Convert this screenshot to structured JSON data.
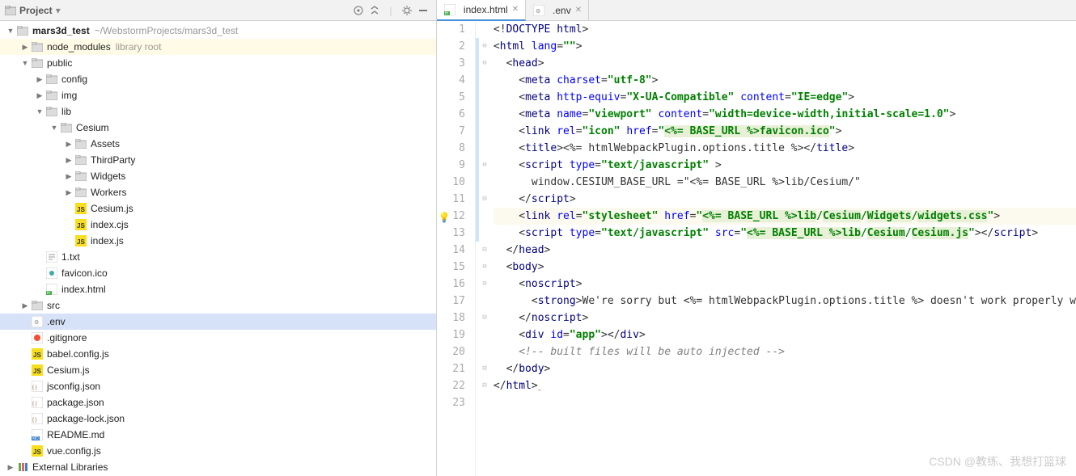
{
  "sidebar": {
    "title": "Project",
    "project_row": {
      "name": "mars3d_test",
      "path": "~/WebstormProjects/mars3d_test"
    },
    "tree": [
      {
        "indent": 0,
        "arrow": "down",
        "icon": "folder-root",
        "label": "mars3d_test",
        "bold": true,
        "hint": "~/WebstormProjects/mars3d_test"
      },
      {
        "indent": 1,
        "arrow": "right",
        "icon": "folder",
        "label": "node_modules",
        "hint": "library root",
        "class": "lib-root"
      },
      {
        "indent": 1,
        "arrow": "down",
        "icon": "folder",
        "label": "public"
      },
      {
        "indent": 2,
        "arrow": "right",
        "icon": "folder",
        "label": "config"
      },
      {
        "indent": 2,
        "arrow": "right",
        "icon": "folder",
        "label": "img"
      },
      {
        "indent": 2,
        "arrow": "down",
        "icon": "folder",
        "label": "lib"
      },
      {
        "indent": 3,
        "arrow": "down",
        "icon": "folder",
        "label": "Cesium"
      },
      {
        "indent": 4,
        "arrow": "right",
        "icon": "folder",
        "label": "Assets"
      },
      {
        "indent": 4,
        "arrow": "right",
        "icon": "folder",
        "label": "ThirdParty"
      },
      {
        "indent": 4,
        "arrow": "right",
        "icon": "folder",
        "label": "Widgets"
      },
      {
        "indent": 4,
        "arrow": "right",
        "icon": "folder",
        "label": "Workers"
      },
      {
        "indent": 4,
        "arrow": "none",
        "icon": "js",
        "label": "Cesium.js"
      },
      {
        "indent": 4,
        "arrow": "none",
        "icon": "js",
        "label": "index.cjs"
      },
      {
        "indent": 4,
        "arrow": "none",
        "icon": "js",
        "label": "index.js"
      },
      {
        "indent": 2,
        "arrow": "none",
        "icon": "txt",
        "label": "1.txt"
      },
      {
        "indent": 2,
        "arrow": "none",
        "icon": "ico",
        "label": "favicon.ico"
      },
      {
        "indent": 2,
        "arrow": "none",
        "icon": "html",
        "label": "index.html"
      },
      {
        "indent": 1,
        "arrow": "right",
        "icon": "folder",
        "label": "src"
      },
      {
        "indent": 1,
        "arrow": "none",
        "icon": "env",
        "label": ".env",
        "class": "selected"
      },
      {
        "indent": 1,
        "arrow": "none",
        "icon": "gitignore",
        "label": ".gitignore"
      },
      {
        "indent": 1,
        "arrow": "none",
        "icon": "js",
        "label": "babel.config.js"
      },
      {
        "indent": 1,
        "arrow": "none",
        "icon": "js",
        "label": "Cesium.js"
      },
      {
        "indent": 1,
        "arrow": "none",
        "icon": "json",
        "label": "jsconfig.json"
      },
      {
        "indent": 1,
        "arrow": "none",
        "icon": "json",
        "label": "package.json"
      },
      {
        "indent": 1,
        "arrow": "none",
        "icon": "json",
        "label": "package-lock.json"
      },
      {
        "indent": 1,
        "arrow": "none",
        "icon": "md",
        "label": "README.md"
      },
      {
        "indent": 1,
        "arrow": "none",
        "icon": "js",
        "label": "vue.config.js"
      },
      {
        "indent": -1,
        "arrow": "right",
        "icon": "ext-lib",
        "label": "External Libraries"
      }
    ]
  },
  "tabs": [
    {
      "icon": "html",
      "label": "index.html",
      "active": true
    },
    {
      "icon": "env",
      "label": ".env",
      "active": false
    }
  ],
  "code": {
    "lines": [
      {
        "n": 1,
        "fold": "",
        "html": "<span class='t-op'>&lt;!</span><span class='t-tag'>DOCTYPE html</span><span class='t-op'>&gt;</span>"
      },
      {
        "n": 2,
        "fold": "⊖",
        "change": true,
        "html": "<span class='t-op'>&lt;</span><span class='t-tag'>html </span><span class='t-attr'>lang</span><span class='t-op'>=</span><span class='t-str'>\"\"</span><span class='t-op'>&gt;</span>"
      },
      {
        "n": 3,
        "fold": "⊖",
        "change": true,
        "html": "  <span class='t-op'>&lt;</span><span class='t-tag'>head</span><span class='t-op'>&gt;</span>"
      },
      {
        "n": 4,
        "fold": "",
        "change": true,
        "html": "    <span class='t-op'>&lt;</span><span class='t-tag'>meta </span><span class='t-attr'>charset</span><span class='t-op'>=</span><span class='t-str'>\"utf-8\"</span><span class='t-op'>&gt;</span>"
      },
      {
        "n": 5,
        "fold": "",
        "change": true,
        "html": "    <span class='t-op'>&lt;</span><span class='t-tag'>meta </span><span class='t-attr'>http-equiv</span><span class='t-op'>=</span><span class='t-str'>\"X-UA-Compatible\"</span> <span class='t-attr'>content</span><span class='t-op'>=</span><span class='t-str'>\"IE=edge\"</span><span class='t-op'>&gt;</span>"
      },
      {
        "n": 6,
        "fold": "",
        "change": true,
        "html": "    <span class='t-op'>&lt;</span><span class='t-tag'>meta </span><span class='t-attr'>name</span><span class='t-op'>=</span><span class='t-str'>\"viewport\"</span> <span class='t-attr'>content</span><span class='t-op'>=</span><span class='t-str'>\"width=device-width,initial-scale=1.0\"</span><span class='t-op'>&gt;</span>"
      },
      {
        "n": 7,
        "fold": "",
        "change": true,
        "html": "    <span class='t-op'>&lt;</span><span class='t-tag'>link </span><span class='t-attr'>rel</span><span class='t-op'>=</span><span class='t-str'>\"icon\"</span> <span class='t-attr'>href</span><span class='t-op'>=</span><span class='t-str'>\"</span><span class='t-hl'>&lt;%= BASE_URL %&gt;</span><span class='t-hl'>favicon.ico</span><span class='t-str'>\"</span><span class='t-op'>&gt;</span>"
      },
      {
        "n": 8,
        "fold": "",
        "change": true,
        "html": "    <span class='t-op'>&lt;</span><span class='t-tag'>title</span><span class='t-op'>&gt;</span><span class='t-plain'>&lt;%= htmlWebpackPlugin.options.title %&gt;</span><span class='t-op'>&lt;/</span><span class='t-tag'>title</span><span class='t-op'>&gt;</span>"
      },
      {
        "n": 9,
        "fold": "⊖",
        "change": true,
        "html": "    <span class='t-op'>&lt;</span><span class='t-tag'>script </span><span class='t-attr'>type</span><span class='t-op'>=</span><span class='t-str'>\"text/javascript\"</span> <span class='t-op'>&gt;</span>"
      },
      {
        "n": 10,
        "fold": "",
        "change": true,
        "html": "      <span class='t-plain'>window.CESIUM_BASE_URL =\"&lt;%= BASE_URL %&gt;lib/Cesium/\"</span>"
      },
      {
        "n": 11,
        "fold": "⊟",
        "change": true,
        "html": "    <span class='t-op'>&lt;/</span><span class='t-tag'>script</span><span class='t-op'>&gt;</span>"
      },
      {
        "n": 12,
        "fold": "",
        "change": true,
        "mark": "bulb",
        "hl": true,
        "html": "    <span class='t-op'>&lt;</span><span class='t-tag'>link </span><span class='t-attr'>rel</span><span class='t-op'>=</span><span class='t-str'>\"stylesheet\"</span> <span class='t-attr'>href</span><span class='t-op'>=</span><span class='t-str'>\"</span><span class='t-hl'>&lt;%= BASE_URL %&gt;</span><span class='t-hl'>lib</span><span class='t-str'>/</span><span class='t-hl'>Cesium</span><span class='t-str'>/</span><span class='t-hl'>Widgets</span><span class='t-str'>/</span><span class='t-hl'>widgets.css</span><span class='t-str'>\"</span><span class='t-op'>&gt;</span>"
      },
      {
        "n": 13,
        "fold": "",
        "change": true,
        "html": "    <span class='t-op'>&lt;</span><span class='t-tag'>script </span><span class='t-attr'>type</span><span class='t-op'>=</span><span class='t-str'>\"text/javascript\"</span> <span class='t-attr'>src</span><span class='t-op'>=</span><span class='t-str'>\"</span><span class='t-hl'>&lt;%= BASE_URL %&gt;</span><span class='t-hl'>lib</span><span class='t-str'>/</span><span class='t-hl'>Cesium</span><span class='t-str'>/</span><span class='t-hl'>Cesium.js</span><span class='t-str'>\"</span><span class='t-op'>&gt;&lt;/</span><span class='t-tag'>script</span><span class='t-op'>&gt;</span>"
      },
      {
        "n": 14,
        "fold": "⊟",
        "html": "  <span class='t-op'>&lt;/</span><span class='t-tag'>head</span><span class='t-op'>&gt;</span>"
      },
      {
        "n": 15,
        "fold": "⊖",
        "html": "  <span class='t-op'>&lt;</span><span class='t-tag'>body</span><span class='t-op'>&gt;</span>"
      },
      {
        "n": 16,
        "fold": "⊖",
        "html": "    <span class='t-op'>&lt;</span><span class='t-tag'>noscript</span><span class='t-op'>&gt;</span>"
      },
      {
        "n": 17,
        "fold": "",
        "html": "      <span class='t-op'>&lt;</span><span class='t-tag'>strong</span><span class='t-op'>&gt;</span><span class='t-plain'>We're sorry but &lt;%= htmlWebpackPlugin.options.title %&gt; doesn't work properly w</span>"
      },
      {
        "n": 18,
        "fold": "⊟",
        "html": "    <span class='t-op'>&lt;/</span><span class='t-tag'>noscript</span><span class='t-op'>&gt;</span>"
      },
      {
        "n": 19,
        "fold": "",
        "html": "    <span class='t-op'>&lt;</span><span class='t-tag'>div </span><span class='t-attr'>id</span><span class='t-op'>=</span><span class='t-str'>\"app\"</span><span class='t-op'>&gt;&lt;/</span><span class='t-tag'>div</span><span class='t-op'>&gt;</span>"
      },
      {
        "n": 20,
        "fold": "",
        "html": "    <span class='t-comment'>&lt;!-- built files will be auto injected --&gt;</span>"
      },
      {
        "n": 21,
        "fold": "⊟",
        "html": "  <span class='t-op'>&lt;/</span><span class='t-tag'>body</span><span class='t-op'>&gt;</span>"
      },
      {
        "n": 22,
        "fold": "⊟",
        "html": "<span class='t-op'>&lt;/</span><span class='t-tag'>html</span><span class='t-op'>&gt;</span><span style='color:#c88'>˷</span>"
      },
      {
        "n": 23,
        "fold": "",
        "html": ""
      }
    ]
  },
  "watermark": "CSDN @教练、我想打篮球"
}
